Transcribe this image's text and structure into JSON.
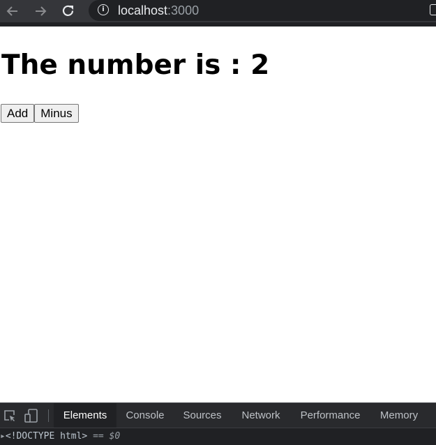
{
  "browser": {
    "back_icon": "arrow-left-icon",
    "forward_icon": "arrow-right-icon",
    "reload_icon": "reload-icon",
    "info_icon": "info-icon",
    "url_host": "localhost",
    "url_port": ":3000"
  },
  "page": {
    "title": "The number is : 2",
    "buttons": {
      "add_label": "Add",
      "minus_label": "Minus"
    }
  },
  "devtools": {
    "tabs": [
      {
        "label": "Elements",
        "active": true
      },
      {
        "label": "Console",
        "active": false
      },
      {
        "label": "Sources",
        "active": false
      },
      {
        "label": "Network",
        "active": false
      },
      {
        "label": "Performance",
        "active": false
      },
      {
        "label": "Memory",
        "active": false
      }
    ],
    "dom_line": {
      "doctype": "<!DOCTYPE html>",
      "equals": "==",
      "ref": "$0"
    }
  },
  "colors": {
    "chrome_bg": "#35363a",
    "omnibox_bg": "#202124",
    "devtools_bg": "#292a2d",
    "active_tab_bg": "#202124"
  }
}
